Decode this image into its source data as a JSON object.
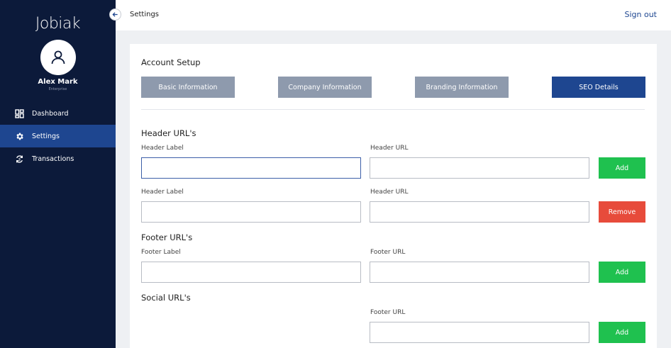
{
  "app": {
    "logo": "Jobiak"
  },
  "user": {
    "name": "Alex Mark",
    "role": "Enterprise"
  },
  "sidebar": {
    "items": [
      {
        "label": "Dashboard",
        "icon": "dashboard-icon",
        "active": false
      },
      {
        "label": "Settings",
        "icon": "gear-icon",
        "active": true
      },
      {
        "label": "Transactions",
        "icon": "transactions-icon",
        "active": false
      }
    ]
  },
  "header": {
    "title": "Settings",
    "signout": "Sign out"
  },
  "account": {
    "title": "Account Setup",
    "tabs": [
      {
        "label": "Basic Information",
        "active": false
      },
      {
        "label": "Company Information",
        "active": false
      },
      {
        "label": "Branding Information",
        "active": false
      },
      {
        "label": "SEO Details",
        "active": true
      }
    ]
  },
  "header_urls": {
    "title": "Header URL's",
    "rows": [
      {
        "label_caption": "Header Label",
        "url_caption": "Header URL",
        "label_value": "",
        "url_value": "",
        "action": "Add"
      },
      {
        "label_caption": "Header Label",
        "url_caption": "Header URL",
        "label_value": "",
        "url_value": "",
        "action": "Remove"
      }
    ]
  },
  "footer_urls": {
    "title": "Footer URL's",
    "rows": [
      {
        "label_caption": "Footer Label",
        "url_caption": "Footer URL",
        "label_value": "",
        "url_value": "",
        "action": "Add"
      }
    ]
  },
  "social_urls": {
    "title": "Social URL's",
    "rows": [
      {
        "url_caption": "Footer URL",
        "url_value": "",
        "action": "Add"
      }
    ]
  },
  "colors": {
    "sidebar": "#0c1a3a",
    "accent": "#1e4690",
    "tab_inactive": "#8e9aad",
    "add": "#1fc14f",
    "remove": "#e74b3b"
  }
}
